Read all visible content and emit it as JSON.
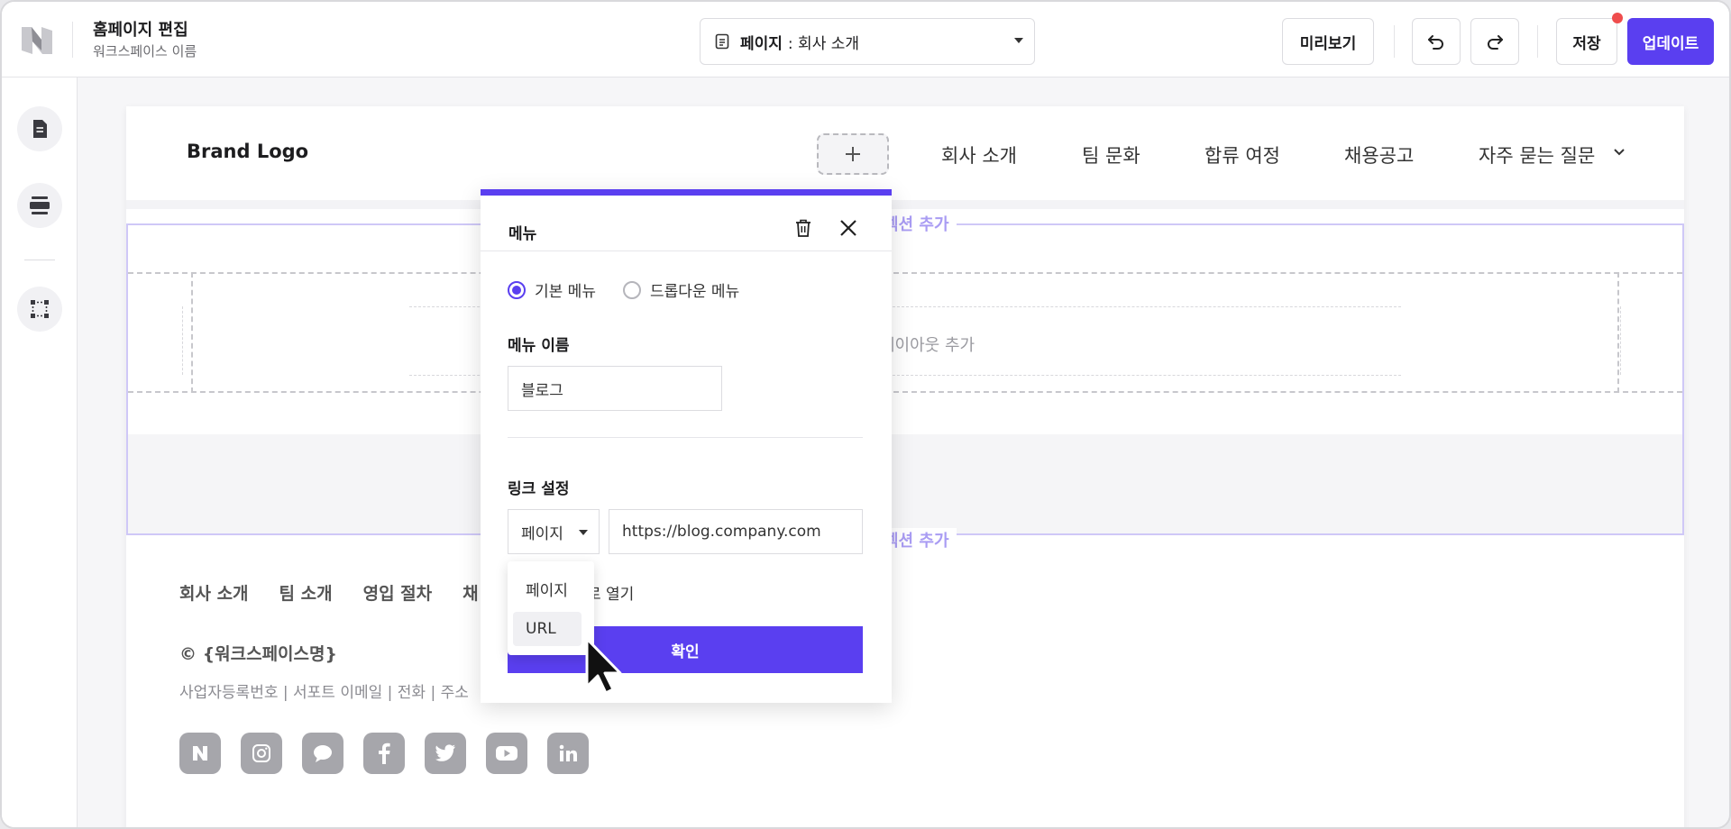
{
  "header": {
    "title": "홈페이지 편집",
    "subtitle": "워크스페이스 이름",
    "page_select_label": "페이지",
    "page_select_value": ": 회사 소개",
    "preview_label": "미리보기",
    "save_label": "저장",
    "update_label": "업데이트"
  },
  "site": {
    "brand": "Brand Logo",
    "nav": [
      "회사 소개",
      "팀 문화",
      "합류 여정",
      "채용공고",
      "자주 묻는 질문"
    ],
    "section_add_top": "섹션 추가",
    "layout_add": "레이아웃 추가",
    "section_add_bottom": "섹션 추가",
    "footer_links": [
      "회사 소개",
      "팀 소개",
      "영입 절차",
      "채"
    ],
    "copyright": "© {워크스페이스명}",
    "biz_info": "사업자등록번호 | 서포트 이메일 | 전화 | 주소",
    "socials": [
      "naver-icon",
      "instagram-icon",
      "chat-icon",
      "facebook-icon",
      "twitter-icon",
      "youtube-icon",
      "linkedin-icon"
    ]
  },
  "popover": {
    "title": "메뉴",
    "radio_basic": "기본 메뉴",
    "radio_dropdown": "드롭다운 메뉴",
    "menu_name_label": "메뉴 이름",
    "menu_name_value": "블로그",
    "link_label": "링크 설정",
    "link_type": "페이지",
    "url_value": "https://blog.company.com",
    "new_tab_label": "새 창 열기",
    "new_tab_visible": "로 열기",
    "confirm_label": "확인",
    "dropdown_options": [
      "페이지",
      "URL"
    ]
  },
  "colors": {
    "accent": "#5a3ff0",
    "notification": "#ef4d4d"
  }
}
